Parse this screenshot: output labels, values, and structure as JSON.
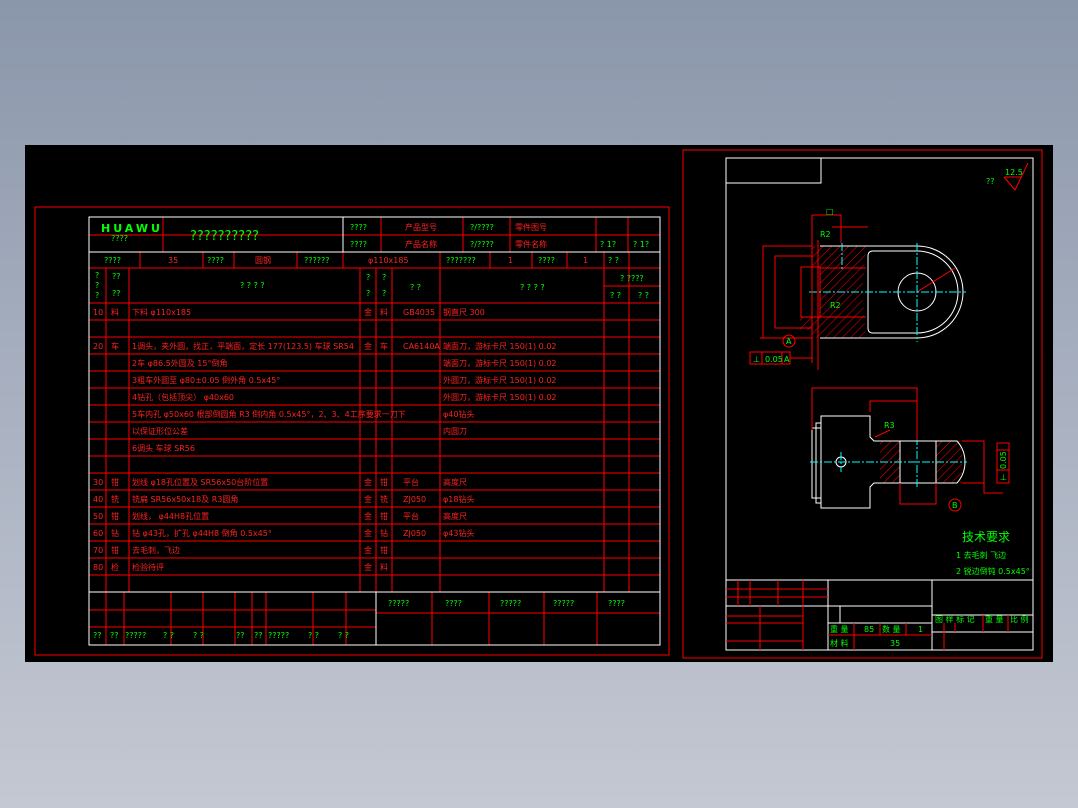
{
  "colors": {
    "background": "#000000",
    "frame": "#ff0000",
    "border": "#ffffff",
    "text_label": "#00ff00",
    "text_content": "#ff2020",
    "centerline": "#00ffff"
  },
  "process_card": {
    "logo": "HUAWU",
    "logo_sub": "????",
    "title": "??????????",
    "header": {
      "cells_row1": [
        "????",
        "产品型号",
        "?/????",
        "零件图号"
      ],
      "cells_row2": [
        "????",
        "产品名称",
        "?/????",
        "零件名称",
        "? 1?",
        "? 1?"
      ],
      "cells_row3": [
        "????",
        "35",
        "????",
        "圆钢",
        "??????",
        "φ110x185",
        "???????",
        "1",
        "????",
        "1",
        "? ?"
      ],
      "columns": [
        "?",
        "?",
        "?",
        "??",
        "??",
        "? ? ? ?",
        "?",
        "?",
        "?",
        "?",
        "? ?",
        "? ? ? ?",
        "? ????",
        "? ?",
        "? ?"
      ]
    },
    "rows": [
      {
        "no": "10",
        "op": "料",
        "content": "下料 φ110x185",
        "shop": "金",
        "section": "料",
        "equipment": "GB4035",
        "tooling": "钢直尺 300"
      },
      {
        "no": "",
        "op": "",
        "content": "",
        "shop": "",
        "section": "",
        "equipment": "",
        "tooling": ""
      },
      {
        "no": "20",
        "op": "车",
        "content": "1调头，夹外圆，找正，平端面，定长 177(123.5) 车球 SR54",
        "shop": "金",
        "section": "车",
        "equipment": "CA6140A",
        "tooling": "端面刀，游标卡尺 150(1) 0.02"
      },
      {
        "no": "",
        "op": "",
        "content": "2车 φ86.5外圆及 15°倒角",
        "shop": "",
        "section": "",
        "equipment": "",
        "tooling": "端面刀，游标卡尺 150(1) 0.02"
      },
      {
        "no": "",
        "op": "",
        "content": "3粗车外圆至 φ80±0.05  倒外角 0.5x45°",
        "shop": "",
        "section": "",
        "equipment": "",
        "tooling": "外圆刀，游标卡尺 150(1) 0.02"
      },
      {
        "no": "",
        "op": "",
        "content": "4钻孔（包括顶尖） φ40x60",
        "shop": "",
        "section": "",
        "equipment": "",
        "tooling": "外圆刀，游标卡尺 150(1) 0.02"
      },
      {
        "no": "",
        "op": "",
        "content": "5车内孔 φ50x60 根部倒圆角 R3 倒内角 0.5x45°，2、3、4工序要求一刀下",
        "shop": "",
        "section": "",
        "equipment": "",
        "tooling": "φ40钻头"
      },
      {
        "no": "",
        "op": "",
        "content": "以保证形位公差",
        "shop": "",
        "section": "",
        "equipment": "",
        "tooling": "内圆刀"
      },
      {
        "no": "",
        "op": "",
        "content": "6调头  车球 SR56",
        "shop": "",
        "section": "",
        "equipment": "",
        "tooling": ""
      },
      {
        "no": "",
        "op": "",
        "content": "",
        "shop": "",
        "section": "",
        "equipment": "",
        "tooling": ""
      },
      {
        "no": "30",
        "op": "钳",
        "content": "划线 φ18孔位置及 SR56x50台阶位置",
        "shop": "金",
        "section": "钳",
        "equipment": "平台",
        "tooling": "高度尺"
      },
      {
        "no": "40",
        "op": "铣",
        "content": "铣扁 SR56x50x18及 R3圆角",
        "shop": "金",
        "section": "铣",
        "equipment": "ZJ050",
        "tooling": "φ18钻头"
      },
      {
        "no": "50",
        "op": "钳",
        "content": "划线， φ44H8孔位置",
        "shop": "金",
        "section": "钳",
        "equipment": "平台",
        "tooling": "高度尺"
      },
      {
        "no": "60",
        "op": "钻",
        "content": "钻 φ43孔，扩孔 φ44H8  倒角 0.5x45°",
        "shop": "金",
        "section": "钻",
        "equipment": "ZJ050",
        "tooling": "φ43钻头"
      },
      {
        "no": "70",
        "op": "钳",
        "content": "去毛刺，飞边",
        "shop": "金",
        "section": "钳",
        "equipment": "",
        "tooling": ""
      },
      {
        "no": "80",
        "op": "检",
        "content": "检验待评",
        "shop": "金",
        "section": "料",
        "equipment": "",
        "tooling": ""
      },
      {
        "no": "",
        "op": "",
        "content": "",
        "shop": "",
        "section": "",
        "equipment": "",
        "tooling": ""
      }
    ],
    "footer_right": [
      "?????",
      "????",
      "?????",
      "?????",
      "????"
    ],
    "footer_left": [
      "??",
      "??",
      "?????",
      "? ?",
      "? ?",
      "??",
      "??",
      "?????",
      "? ?",
      "? ?"
    ]
  },
  "part_drawing": {
    "roughness": "12.5",
    "roughness_label": "??",
    "dims": {
      "r2": "R2",
      "r3": "R3",
      "tol": "0.05",
      "datum_a": "A",
      "datum_b": "B",
      "perp": "⊥"
    },
    "tech_req_title": "技术要求",
    "tech_req": [
      "1 去毛刺 飞边",
      "2 锐边倒钝 0.5x45°"
    ],
    "title_block": {
      "weight_label": "重 量",
      "weight": "85",
      "qty_label": "数 量",
      "qty": "1",
      "material_label": "材 料",
      "material": "35",
      "scale_labels": [
        "图 样 标 记",
        "重 量",
        "比 例"
      ]
    }
  }
}
